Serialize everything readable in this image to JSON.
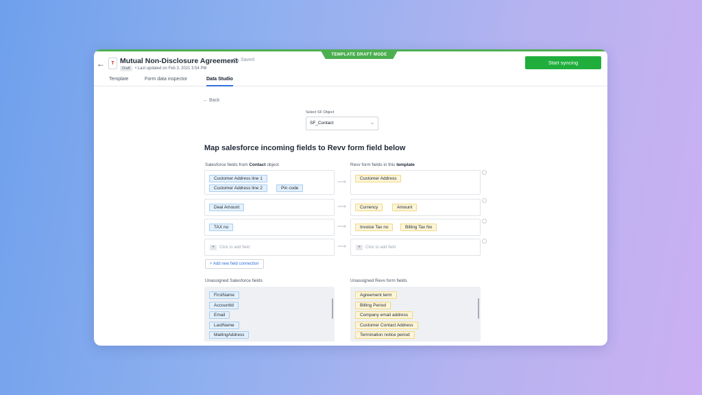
{
  "header": {
    "mode_badge": "TEMPLATE DRAFT MODE",
    "doc_icon_letter": "T",
    "doc_title": "Mutual Non-Disclosure Agreement",
    "saved_label": "Saved",
    "draft_badge": "Draft",
    "updated_text": "• Last updated on Feb 3, 2021 3:54 PM",
    "start_button": "Start syncing"
  },
  "tabs": [
    {
      "label": "Template",
      "active": false
    },
    {
      "label": "Form data inspector",
      "active": false
    },
    {
      "label": "Data Studio",
      "active": true
    }
  ],
  "main": {
    "back_label": "Back",
    "select_label": "Select SF Object",
    "select_value": "SF_Contact",
    "heading": "Map salesforce incoming fields to Revv form field below",
    "sf_col_prefix": "Salesforce fields from ",
    "sf_col_object": "Contact",
    "sf_col_suffix": " object",
    "rv_col_prefix": "Revv form fields in this ",
    "rv_col_bold": "template",
    "mappings": [
      {
        "sf": [
          "Customer Address line 1",
          "Customer Address line 2",
          "Pin code"
        ],
        "revv": [
          "Customer Address"
        ]
      },
      {
        "sf": [
          "Deal Amount"
        ],
        "revv": [
          "Currency",
          "Amount"
        ]
      },
      {
        "sf": [
          "TAX no"
        ],
        "revv": [
          "Invoice Tax no",
          "Billing Tax No"
        ]
      }
    ],
    "add_field_label": "Click to add field",
    "add_connection": "Add new field connection",
    "unassigned_sf_label": "Unassigned Salesforce fields",
    "unassigned_rv_label": "Unassigned Revv form fields",
    "unassigned_sf": [
      "FirstName",
      "AccountId",
      "Email",
      "LastName",
      "MailingAddress"
    ],
    "unassigned_rv": [
      "Agreement term",
      "Billing Period",
      "Company email address",
      "Customer Contact Address",
      "Termination notice period"
    ]
  },
  "colors": {
    "accent": "#1fae3c",
    "draft_mode": "#4caf50",
    "link": "#2f6fe0"
  }
}
